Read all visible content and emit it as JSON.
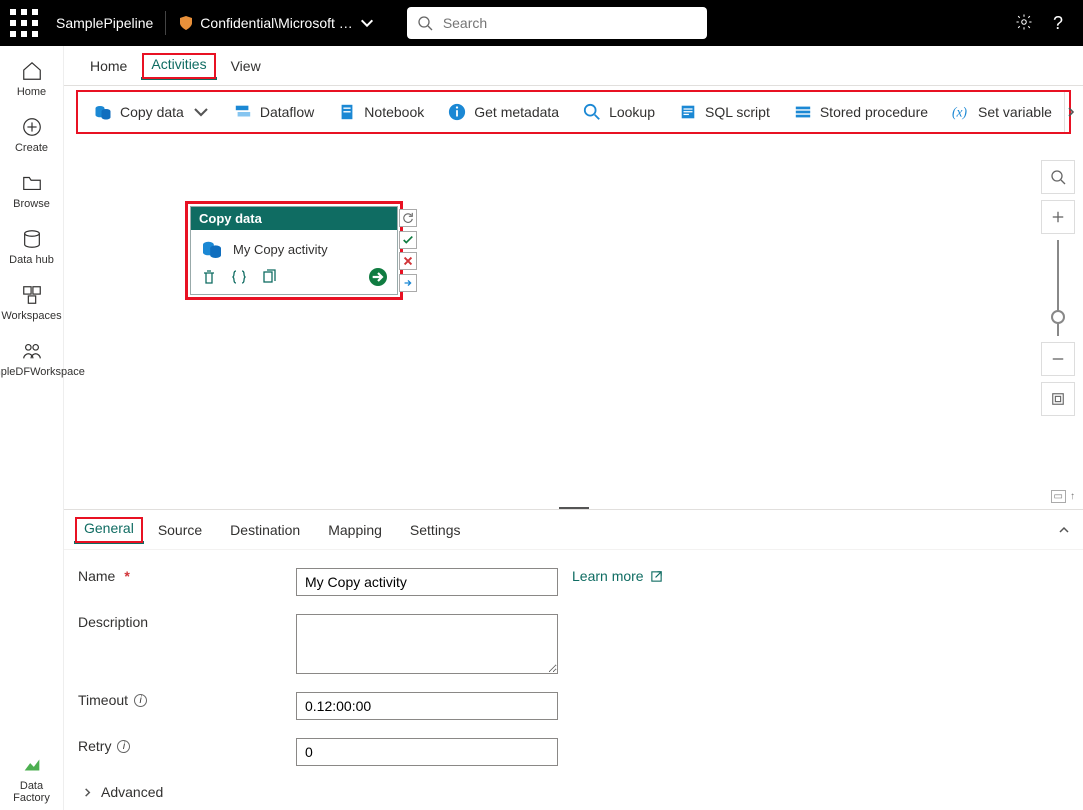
{
  "topbar": {
    "pipeline": "SamplePipeline",
    "sensitivity": "Confidential\\Microsoft …",
    "search_placeholder": "Search"
  },
  "leftrail": {
    "items": [
      {
        "label": "Home"
      },
      {
        "label": "Create"
      },
      {
        "label": "Browse"
      },
      {
        "label": "Data hub"
      },
      {
        "label": "Workspaces"
      },
      {
        "label": "SampleDFWorkspace"
      }
    ],
    "footer": {
      "label": "Data Factory"
    }
  },
  "maintabs": {
    "items": [
      {
        "label": "Home",
        "active": false
      },
      {
        "label": "Activities",
        "active": true
      },
      {
        "label": "View",
        "active": false
      }
    ]
  },
  "ribbon": {
    "items": [
      {
        "label": "Copy data",
        "hasDropdown": true
      },
      {
        "label": "Dataflow"
      },
      {
        "label": "Notebook"
      },
      {
        "label": "Get metadata"
      },
      {
        "label": "Lookup"
      },
      {
        "label": "SQL script"
      },
      {
        "label": "Stored procedure"
      },
      {
        "label": "Set variable"
      }
    ]
  },
  "node": {
    "title": "Copy data",
    "activity_name": "My Copy activity"
  },
  "proptabs": {
    "items": [
      {
        "label": "General",
        "active": true
      },
      {
        "label": "Source"
      },
      {
        "label": "Destination"
      },
      {
        "label": "Mapping"
      },
      {
        "label": "Settings"
      }
    ]
  },
  "form": {
    "name_label": "Name",
    "name_value": "My Copy activity",
    "learn_more": "Learn more",
    "desc_label": "Description",
    "desc_value": "",
    "timeout_label": "Timeout",
    "timeout_value": "0.12:00:00",
    "retry_label": "Retry",
    "retry_value": "0",
    "advanced_label": "Advanced"
  }
}
